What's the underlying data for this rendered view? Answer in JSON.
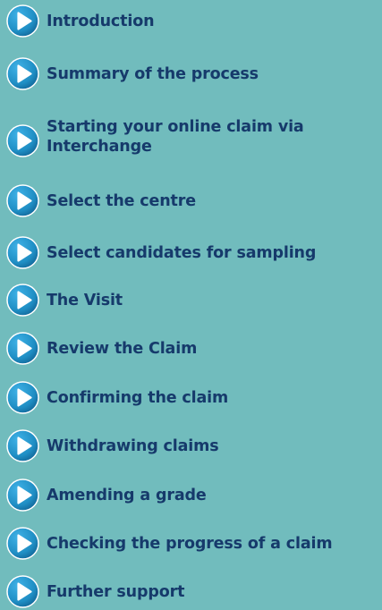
{
  "menu": {
    "items": [
      {
        "label": "Introduction",
        "icon": "play-arrow-icon"
      },
      {
        "label": "Summary of the process",
        "icon": "play-arrow-icon"
      },
      {
        "label": "Starting your online claim via Interchange",
        "icon": "play-arrow-icon"
      },
      {
        "label": "Select the centre",
        "icon": "play-arrow-icon"
      },
      {
        "label": "Select candidates for sampling",
        "icon": "play-arrow-icon"
      },
      {
        "label": "The Visit",
        "icon": "play-arrow-icon"
      },
      {
        "label": "Review the Claim",
        "icon": "play-arrow-icon"
      },
      {
        "label": "Confirming the claim",
        "icon": "play-arrow-icon"
      },
      {
        "label": "Withdrawing claims",
        "icon": "play-arrow-icon"
      },
      {
        "label": "Amending a grade",
        "icon": "play-arrow-icon"
      },
      {
        "label": "Checking the progress of a claim",
        "icon": "play-arrow-icon"
      },
      {
        "label": "Further support",
        "icon": "play-arrow-icon"
      }
    ]
  },
  "colors": {
    "background": "#71bcbd",
    "text": "#163a6b",
    "icon_fill": "#1f8ec4",
    "icon_arrow": "#ffffff"
  }
}
